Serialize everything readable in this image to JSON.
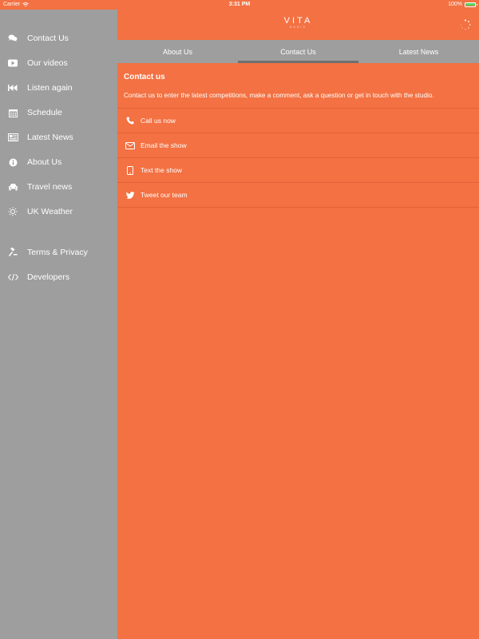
{
  "status_bar": {
    "carrier": "Carrier",
    "time": "3:31 PM",
    "battery": "100%"
  },
  "sidebar": {
    "items": [
      {
        "label": "Contact Us",
        "icon": "chat-bubbles-icon"
      },
      {
        "label": "Our videos",
        "icon": "youtube-icon"
      },
      {
        "label": "Listen again",
        "icon": "rewind-icon"
      },
      {
        "label": "Schedule",
        "icon": "calendar-icon"
      },
      {
        "label": "Latest News",
        "icon": "newspaper-icon"
      },
      {
        "label": "About Us",
        "icon": "info-icon"
      },
      {
        "label": "Travel news",
        "icon": "car-icon"
      },
      {
        "label": "UK Weather",
        "icon": "sun-icon"
      },
      {
        "label": "Terms & Privacy",
        "icon": "gavel-icon"
      },
      {
        "label": "Developers",
        "icon": "code-icon"
      }
    ]
  },
  "header": {
    "logo_text": "VITA",
    "logo_subtext": "RADIO"
  },
  "tabs": [
    {
      "label": "About Us",
      "active": false
    },
    {
      "label": "Contact Us",
      "active": true
    },
    {
      "label": "Latest News",
      "active": false
    }
  ],
  "content": {
    "title": "Contact us",
    "description": "Contact us to enter the latest competitions, make a comment, ask a question or get in touch with the studio.",
    "actions": [
      {
        "label": "Call us now",
        "icon": "phone-icon"
      },
      {
        "label": "Email the show",
        "icon": "envelope-icon"
      },
      {
        "label": "Text the show",
        "icon": "mobile-icon"
      },
      {
        "label": "Tweet our team",
        "icon": "twitter-icon"
      }
    ]
  },
  "colors": {
    "accent": "#f37142",
    "sidebar_bg": "#9e9e9e",
    "tab_indicator": "#6f6f6f"
  }
}
